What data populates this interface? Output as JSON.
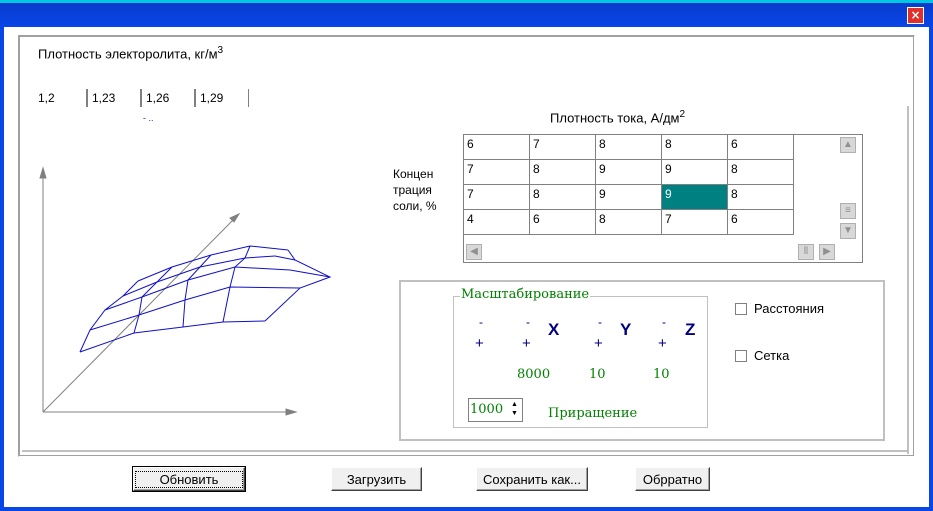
{
  "window": {
    "close_glyph": "×"
  },
  "density": {
    "label": "Плотность электоролита, кг/м",
    "label_sup": "3",
    "tabs": [
      "1,2",
      "1,23",
      "1,26",
      "1,29"
    ],
    "tab_marker": "- ..",
    "selected_tab": 0
  },
  "current": {
    "label": "Плотность тока, А/дм",
    "label_sup": "2"
  },
  "concentration": {
    "lines": [
      "Концен",
      "трация",
      "соли, %"
    ]
  },
  "grid": {
    "rows": [
      [
        "6",
        "7",
        "8",
        "8",
        "6"
      ],
      [
        "7",
        "8",
        "9",
        "9",
        "8"
      ],
      [
        "7",
        "8",
        "9",
        "9",
        "8"
      ],
      [
        "4",
        "6",
        "8",
        "7",
        "6"
      ]
    ],
    "selected_cell": [
      2,
      3
    ],
    "selected_color": "#008080"
  },
  "scaling": {
    "title": "Масштабирование",
    "minus": "-",
    "plus": "+",
    "axes": [
      "X",
      "Y",
      "Z"
    ],
    "values": [
      "8000",
      "10",
      "10"
    ],
    "increment_value": "1000",
    "increment_label": "Приращение"
  },
  "options": {
    "distances": {
      "label": "Расстояния",
      "checked": false
    },
    "grid": {
      "label": "Сетка",
      "checked": false
    }
  },
  "buttons": {
    "refresh": "Обновить",
    "load": "Загрузить",
    "save_as": "Сохранить как...",
    "back": "Обрратно"
  },
  "colors": {
    "titlebar": "#0846e8",
    "surface_lines": "#1010c8",
    "accent_green": "#008000"
  }
}
